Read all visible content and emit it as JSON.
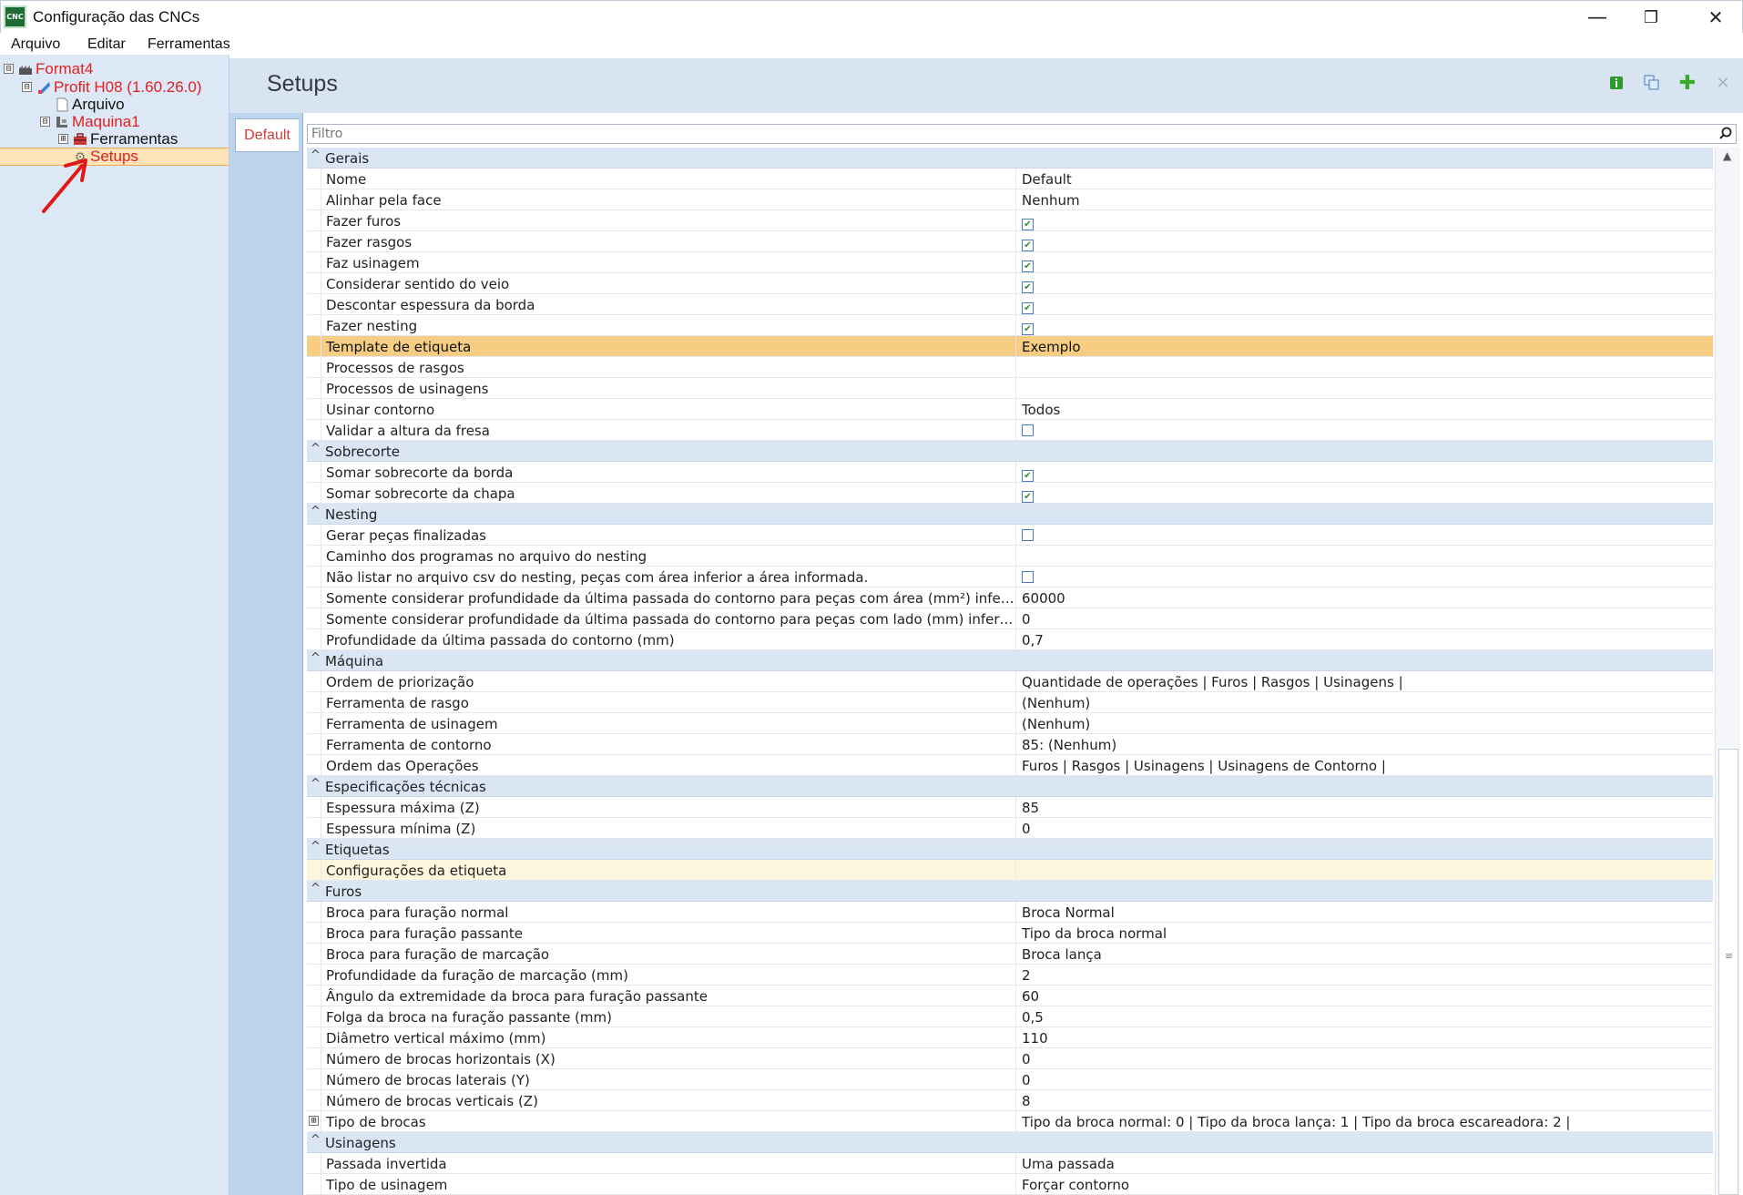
{
  "window": {
    "title": "Configuração das CNCs",
    "icon_label": "CNC",
    "minimize": "—",
    "maximize": "❐",
    "close": "✕"
  },
  "menu": [
    "Arquivo",
    "Editar",
    "Ferramentas"
  ],
  "tree": [
    {
      "label": "Format4",
      "color": "#e02020",
      "icon": "factory-icon",
      "expander": "⊟"
    },
    {
      "label": "Profit H08 (1.60.26.0)",
      "color": "#e02020",
      "icon": "software-icon",
      "expander": "⊟"
    },
    {
      "label": "Arquivo",
      "color": "#111111",
      "icon": "file-icon",
      "expander": ""
    },
    {
      "label": "Maquina1",
      "color": "#e02020",
      "icon": "machine-icon",
      "expander": "⊟"
    },
    {
      "label": "Ferramentas",
      "color": "#111111",
      "icon": "toolbox-icon",
      "expander": "⊞"
    },
    {
      "label": "Setups",
      "color": "#e02020",
      "icon": "gear-icon",
      "expander": "",
      "selected": true
    }
  ],
  "header": {
    "title": "Setups"
  },
  "tabs": [
    "Default"
  ],
  "filter": {
    "placeholder": "Filtro"
  },
  "grid": [
    {
      "category": "Gerais",
      "toggle": "^",
      "props": [
        {
          "name": "Nome",
          "value": "Default"
        },
        {
          "name": "Alinhar pela face",
          "value": "Nenhum"
        },
        {
          "name": "Fazer furos",
          "checkbox": true
        },
        {
          "name": "Fazer rasgos",
          "checkbox": true
        },
        {
          "name": "Faz usinagem",
          "checkbox": true
        },
        {
          "name": "Considerar sentido do veio",
          "checkbox": true
        },
        {
          "name": "Descontar espessura da borda",
          "checkbox": true
        },
        {
          "name": "Fazer nesting",
          "checkbox": true
        },
        {
          "name": "Template de etiqueta",
          "value": "Exemplo",
          "highlight": "selected"
        },
        {
          "name": "Processos de rasgos",
          "value": ""
        },
        {
          "name": "Processos de usinagens",
          "value": ""
        },
        {
          "name": "Usinar contorno",
          "value": "Todos"
        },
        {
          "name": "Validar a altura da fresa",
          "checkbox": false
        }
      ]
    },
    {
      "category": "Sobrecorte",
      "toggle": "^",
      "props": [
        {
          "name": "Somar sobrecorte da borda",
          "checkbox": true
        },
        {
          "name": "Somar sobrecorte da chapa",
          "checkbox": true
        }
      ]
    },
    {
      "category": "Nesting",
      "toggle": "^",
      "props": [
        {
          "name": "Gerar peças finalizadas",
          "checkbox": false
        },
        {
          "name": "Caminho dos programas no arquivo do nesting",
          "value": ""
        },
        {
          "name": "Não listar no arquivo csv do nesting, peças com área inferior a área informada.",
          "checkbox": false
        },
        {
          "name": "Somente considerar profundidade da última passada do contorno para peças com área (mm²) infer...",
          "value": "60000"
        },
        {
          "name": "Somente considerar profundidade da última passada do contorno para peças com lado (mm) inferi...",
          "value": "0"
        },
        {
          "name": "Profundidade da última passada do contorno (mm)",
          "value": "0,7"
        }
      ]
    },
    {
      "category": "Máquina",
      "toggle": "^",
      "props": [
        {
          "name": "Ordem de priorização",
          "value": "Quantidade de operações | Furos | Rasgos | Usinagens |"
        },
        {
          "name": "Ferramenta de rasgo",
          "value": "(Nenhum)"
        },
        {
          "name": "Ferramenta de usinagem",
          "value": "(Nenhum)"
        },
        {
          "name": "Ferramenta de contorno",
          "value": "85: (Nenhum)"
        },
        {
          "name": "Ordem das Operações",
          "value": "Furos | Rasgos | Usinagens | Usinagens de Contorno |"
        }
      ]
    },
    {
      "category": "Especificações técnicas",
      "toggle": "^",
      "props": [
        {
          "name": "Espessura máxima (Z)",
          "value": "85"
        },
        {
          "name": "Espessura mínima (Z)",
          "value": "0"
        }
      ]
    },
    {
      "category": "Etiquetas",
      "toggle": "^",
      "props": [
        {
          "name": "Configurações da etiqueta",
          "value": "",
          "highlight": "soft"
        }
      ]
    },
    {
      "category": "Furos",
      "toggle": "^",
      "props": [
        {
          "name": "Broca para furação normal",
          "value": "Broca Normal"
        },
        {
          "name": "Broca para furação passante",
          "value": "Tipo da broca normal"
        },
        {
          "name": "Broca para furação de marcação",
          "value": "Broca lança"
        },
        {
          "name": "Profundidade da furação de marcação (mm)",
          "value": "2"
        },
        {
          "name": "Ângulo da extremidade da broca para furação passante",
          "value": "60"
        },
        {
          "name": "Folga da broca na furação passante (mm)",
          "value": "0,5"
        },
        {
          "name": "Diâmetro vertical máximo (mm)",
          "value": "110"
        },
        {
          "name": "Número de brocas horizontais (X)",
          "value": "0"
        },
        {
          "name": "Número de brocas laterais (Y)",
          "value": "0"
        },
        {
          "name": "Número de brocas verticais (Z)",
          "value": "8"
        },
        {
          "name": "Tipo de brocas",
          "value": "Tipo da broca normal: 0  |  Tipo da broca lança: 1  |  Tipo da broca escareadora: 2  |",
          "expander": "⊞"
        }
      ]
    },
    {
      "category": "Usinagens",
      "toggle": "^",
      "props": [
        {
          "name": "Passada invertida",
          "value": "Uma passada"
        },
        {
          "name": "Tipo de usinagem",
          "value": "Forçar contorno"
        }
      ]
    }
  ],
  "colors": {
    "selected_row": "#f7cc83",
    "category_bg": "#dbe6f4",
    "accent_red": "#e02020",
    "checkbox_check": "#2e8b2e"
  }
}
